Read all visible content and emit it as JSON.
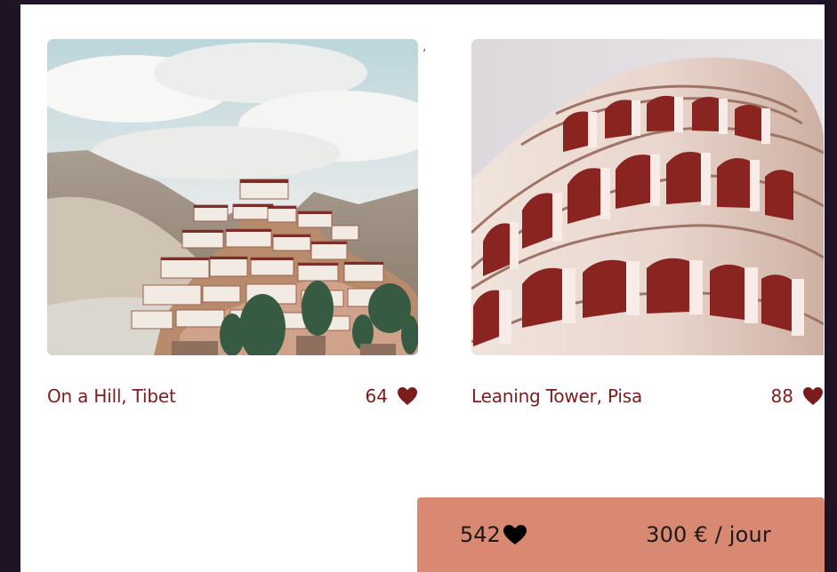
{
  "cards": [
    {
      "title": "On a Hill, Tibet",
      "likes": "64"
    },
    {
      "title": "Leaning Tower, Pisa",
      "likes": "88"
    }
  ],
  "summary": {
    "likes": "542",
    "price": "300 € / jour"
  },
  "colors": {
    "page_background": "#ffffff",
    "outer_background": "#1f1426",
    "title_color": "#7b1d1d",
    "accent_bar": "#d98872",
    "heart_color": "#7b1d1d"
  },
  "icons": {
    "card_heart": "heart-icon",
    "summary_heart": "heart-icon"
  }
}
